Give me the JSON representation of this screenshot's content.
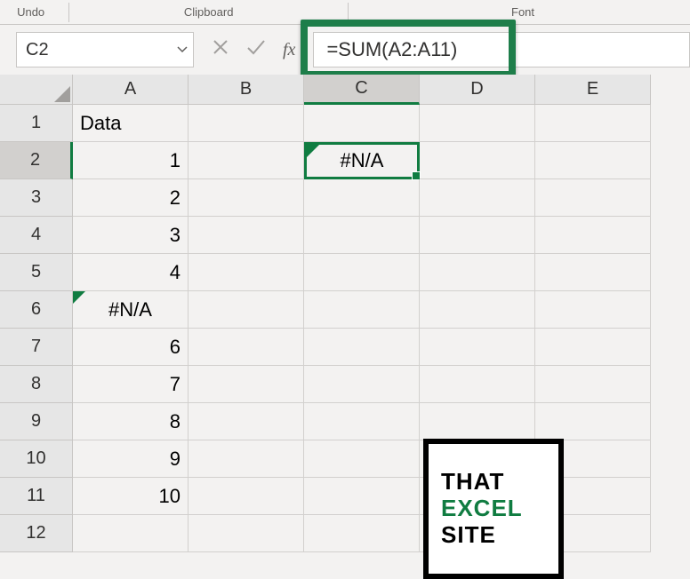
{
  "ribbon": {
    "undo_label": "Undo",
    "clipboard_label": "Clipboard",
    "font_label": "Font"
  },
  "namebox": {
    "value": "C2"
  },
  "formula": {
    "value": "=SUM(A2:A11)"
  },
  "fx_label": "fx",
  "columns": [
    "A",
    "B",
    "C",
    "D",
    "E"
  ],
  "rows": [
    "1",
    "2",
    "3",
    "4",
    "5",
    "6",
    "7",
    "8",
    "9",
    "10",
    "11",
    "12"
  ],
  "active": {
    "col": "C",
    "row": "2"
  },
  "cells": {
    "A1": "Data",
    "A2": "1",
    "A3": "2",
    "A4": "3",
    "A5": "4",
    "A6": "#N/A",
    "A7": "6",
    "A8": "7",
    "A9": "8",
    "A10": "9",
    "A11": "10",
    "C2": "#N/A"
  },
  "watermark": {
    "line1": "THAT",
    "line2": "EXCEL",
    "line3": "SITE"
  }
}
